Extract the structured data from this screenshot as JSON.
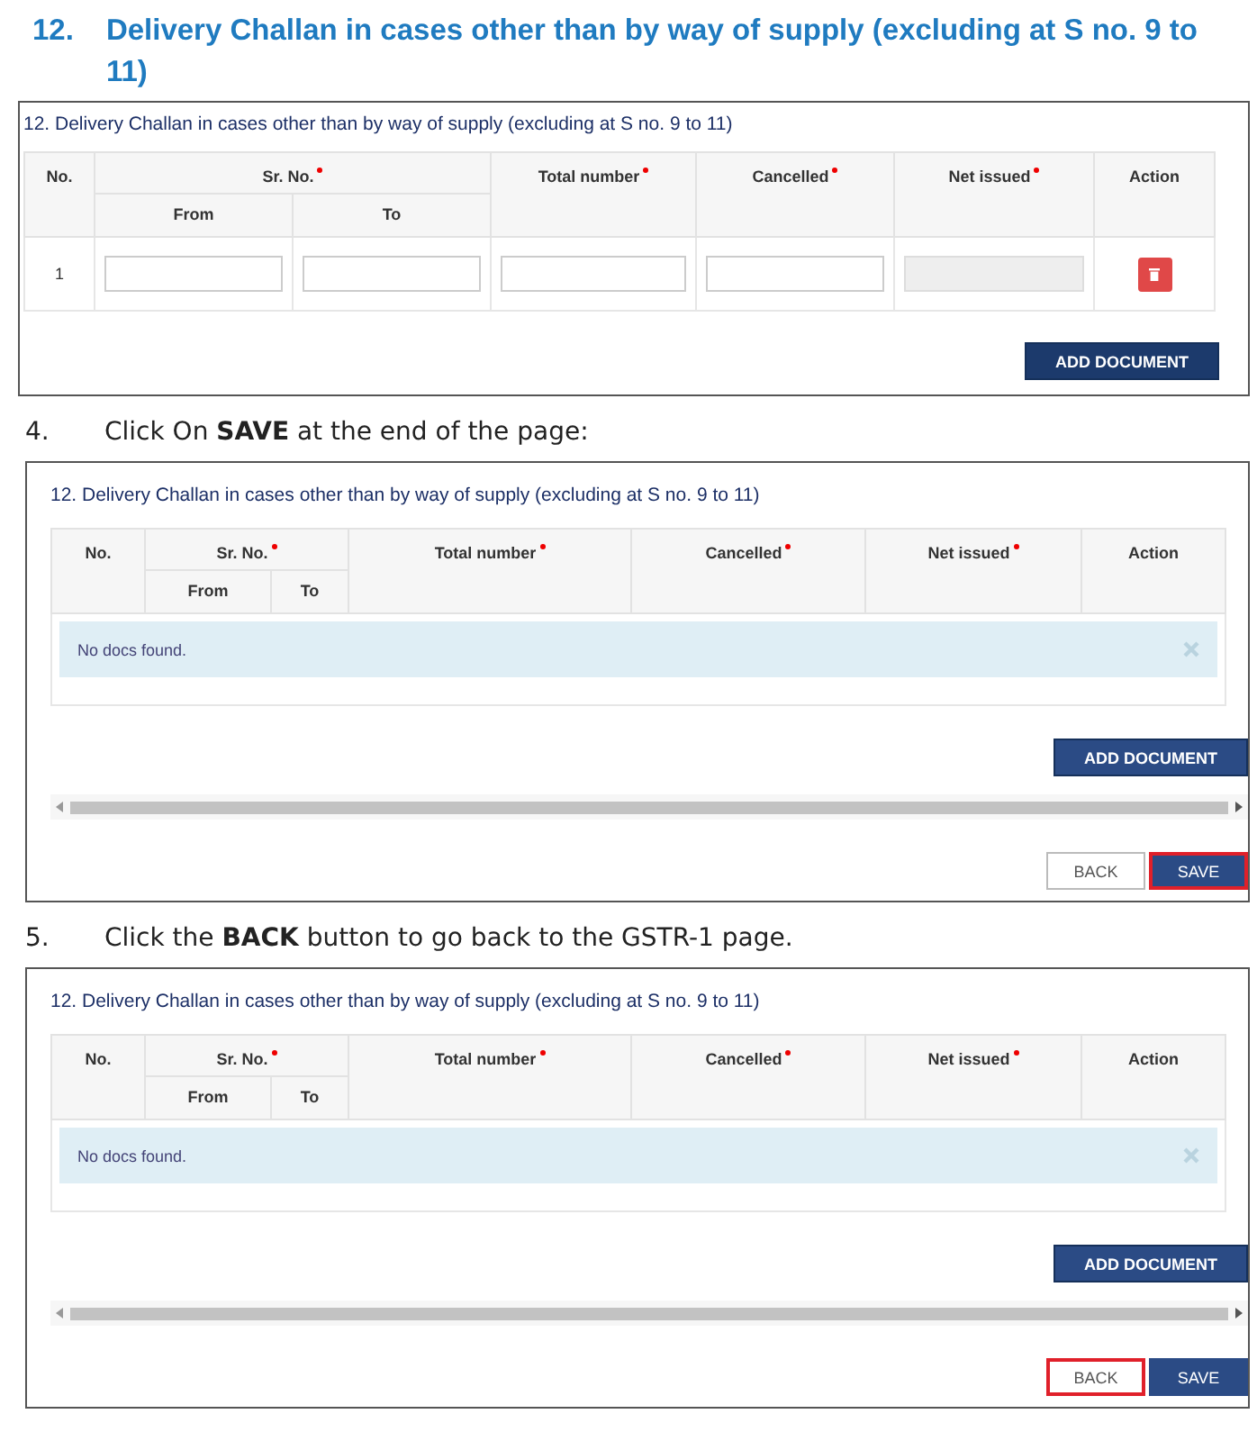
{
  "heading": {
    "number": "12.",
    "text": "Delivery Challan in cases other than by way of supply (excluding at S no. 9 to 11)"
  },
  "blocks": [
    {
      "kind": "panel",
      "title": "12. Delivery Challan in cases other than by way of supply (excluding at S no. 9 to 11)",
      "headers": {
        "no": "No.",
        "sr": "Sr. No.",
        "from": "From",
        "to": "To",
        "total": "Total number",
        "cancelled": "Cancelled",
        "net": "Net issued",
        "action": "Action"
      },
      "required": {
        "sr": true,
        "total": true,
        "cancelled": true,
        "net": true
      },
      "rows": [
        {
          "no": "1",
          "fields": [
            {
              "disabled": false
            },
            {
              "disabled": false
            },
            {
              "disabled": false
            },
            {
              "disabled": false
            },
            {
              "disabled": true
            }
          ]
        }
      ],
      "add_button": "ADD DOCUMENT",
      "scrollbar": false
    },
    {
      "kind": "step",
      "number": "4.",
      "text": "Click On **SAVE** at the end of the page:"
    },
    {
      "kind": "panel",
      "title": "12. Delivery Challan in cases other than by way of supply (excluding at S no. 9 to 11)",
      "headers": {
        "no": "No.",
        "sr": "Sr. No.",
        "from": "From",
        "to": "To",
        "total": "Total number",
        "cancelled": "Cancelled",
        "net": "Net issued",
        "action": "Action"
      },
      "required": {
        "sr": true,
        "total": true,
        "cancelled": true,
        "net": true
      },
      "empty_message": "No docs found.",
      "add_button": "ADD DOCUMENT",
      "scrollbar": true,
      "buttons": [
        {
          "label": "BACK",
          "kind": "secondary",
          "highlighted": false
        },
        {
          "label": "SAVE",
          "kind": "primary",
          "highlighted": true
        }
      ]
    },
    {
      "kind": "step",
      "number": "5.",
      "text": "Click the **BACK** button to go back to the GSTR-1 page."
    },
    {
      "kind": "panel",
      "title": "12. Delivery Challan in cases other than by way of supply (excluding at S no. 9 to 11)",
      "headers": {
        "no": "No.",
        "sr": "Sr. No.",
        "from": "From",
        "to": "To",
        "total": "Total number",
        "cancelled": "Cancelled",
        "net": "Net issued",
        "action": "Action"
      },
      "required": {
        "sr": true,
        "total": true,
        "cancelled": true,
        "net": true
      },
      "empty_message": "No docs found.",
      "add_button": "ADD DOCUMENT",
      "scrollbar": true,
      "buttons": [
        {
          "label": "BACK",
          "kind": "secondary",
          "highlighted": true
        },
        {
          "label": "SAVE",
          "kind": "primary",
          "highlighted": false
        }
      ]
    }
  ]
}
